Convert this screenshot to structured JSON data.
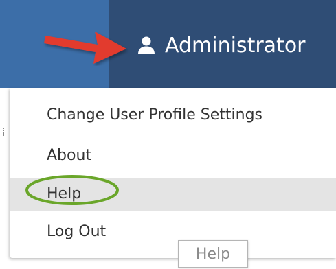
{
  "header": {
    "user_label": "Administrator",
    "user_icon": "user-icon",
    "annotation_arrow_color": "#e23b2e",
    "bar_color": "#2f4d75",
    "left_panel_color": "#3c6ea8"
  },
  "menu": {
    "items": [
      {
        "label": "Change User Profile Settings"
      },
      {
        "label": "About"
      },
      {
        "label": "Help"
      },
      {
        "label": "Log Out"
      }
    ],
    "hovered_item": "Help",
    "hover_background": "#e4e4e4",
    "annotation_circle_color": "#6aa62a"
  },
  "tooltip": {
    "text": "Help"
  }
}
